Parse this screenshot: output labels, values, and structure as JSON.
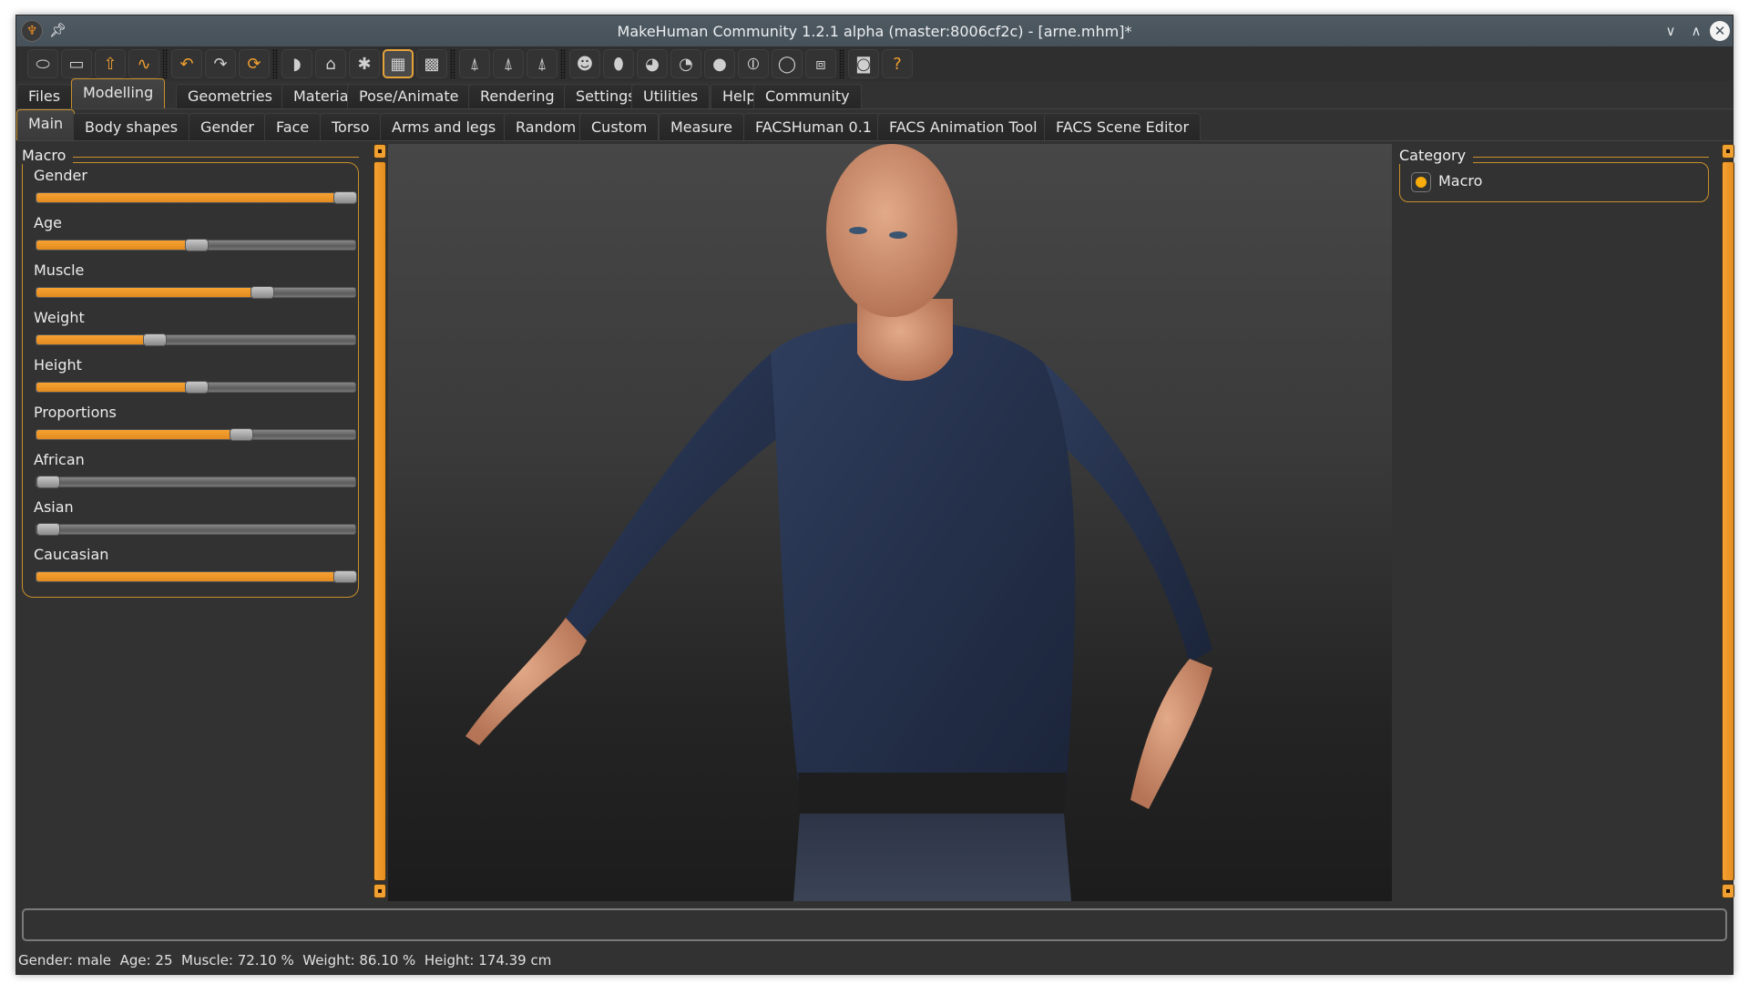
{
  "window": {
    "title": "MakeHuman Community 1.2.1 alpha (master:8006cf2c) - [arne.mhm]*",
    "controls": [
      "minimize",
      "maximize",
      "close"
    ]
  },
  "toolbar": {
    "groups": [
      [
        {
          "name": "files-icon"
        },
        {
          "name": "save-icon"
        },
        {
          "name": "export-icon"
        },
        {
          "name": "load-icon"
        }
      ],
      [
        {
          "name": "undo-icon"
        },
        {
          "name": "redo-icon"
        },
        {
          "name": "reset-icon"
        }
      ],
      [
        {
          "name": "smooth-icon"
        },
        {
          "name": "wireframe-icon"
        },
        {
          "name": "pose-icon"
        },
        {
          "name": "grid-icon",
          "active": true
        },
        {
          "name": "checker-background-icon"
        }
      ],
      [
        {
          "name": "symmetry-right-icon"
        },
        {
          "name": "symmetry-left-icon"
        },
        {
          "name": "symmetry-icon"
        }
      ],
      [
        {
          "name": "front-view-icon"
        },
        {
          "name": "back-view-icon"
        },
        {
          "name": "left-view-icon"
        },
        {
          "name": "right-view-icon"
        },
        {
          "name": "top-view-icon"
        },
        {
          "name": "bottom-view-icon"
        },
        {
          "name": "reset-camera-icon"
        },
        {
          "name": "ortho-toggle-icon"
        }
      ],
      [
        {
          "name": "screenshot-icon"
        },
        {
          "name": "help-icon"
        }
      ]
    ]
  },
  "main_tabs": [
    {
      "label": "Files"
    },
    {
      "label": "Modelling",
      "selected": true
    },
    {
      "label": "Geometries"
    },
    {
      "label": "Materials"
    },
    {
      "label": "Pose/Animate"
    },
    {
      "label": "Rendering"
    },
    {
      "label": "Settings"
    },
    {
      "label": "Utilities"
    },
    {
      "label": "Help"
    },
    {
      "label": "Community"
    }
  ],
  "sub_tabs": [
    {
      "label": "Main",
      "selected": true
    },
    {
      "label": "Body shapes"
    },
    {
      "label": "Gender"
    },
    {
      "label": "Face"
    },
    {
      "label": "Torso"
    },
    {
      "label": "Arms and legs"
    },
    {
      "label": "Random"
    },
    {
      "label": "Custom"
    },
    {
      "label": "Measure"
    },
    {
      "label": "FACSHuman 0.1"
    },
    {
      "label": "FACS Animation Tool"
    },
    {
      "label": "FACS Scene Editor"
    }
  ],
  "macro": {
    "title": "Macro",
    "sliders": [
      {
        "label": "Gender",
        "value": 1.0
      },
      {
        "label": "Age",
        "value": 0.5
      },
      {
        "label": "Muscle",
        "value": 0.721
      },
      {
        "label": "Weight",
        "value": 0.36
      },
      {
        "label": "Height",
        "value": 0.5
      },
      {
        "label": "Proportions",
        "value": 0.65
      },
      {
        "label": "African",
        "value": 0.0
      },
      {
        "label": "Asian",
        "value": 0.0
      },
      {
        "label": "Caucasian",
        "value": 1.0
      }
    ]
  },
  "category": {
    "title": "Category",
    "options": [
      {
        "label": "Macro",
        "selected": true
      }
    ]
  },
  "log": {
    "value": ""
  },
  "status": {
    "text": "Gender: male  Age: 25  Muscle: 72.10 %  Weight: 86.10 %  Height: 174.39 cm"
  },
  "colors": {
    "accent": "#f0a030",
    "panel_bg": "#323232",
    "titlebar": "#4a555e",
    "shirt": "#26334f",
    "skin": "#d69a7a"
  }
}
